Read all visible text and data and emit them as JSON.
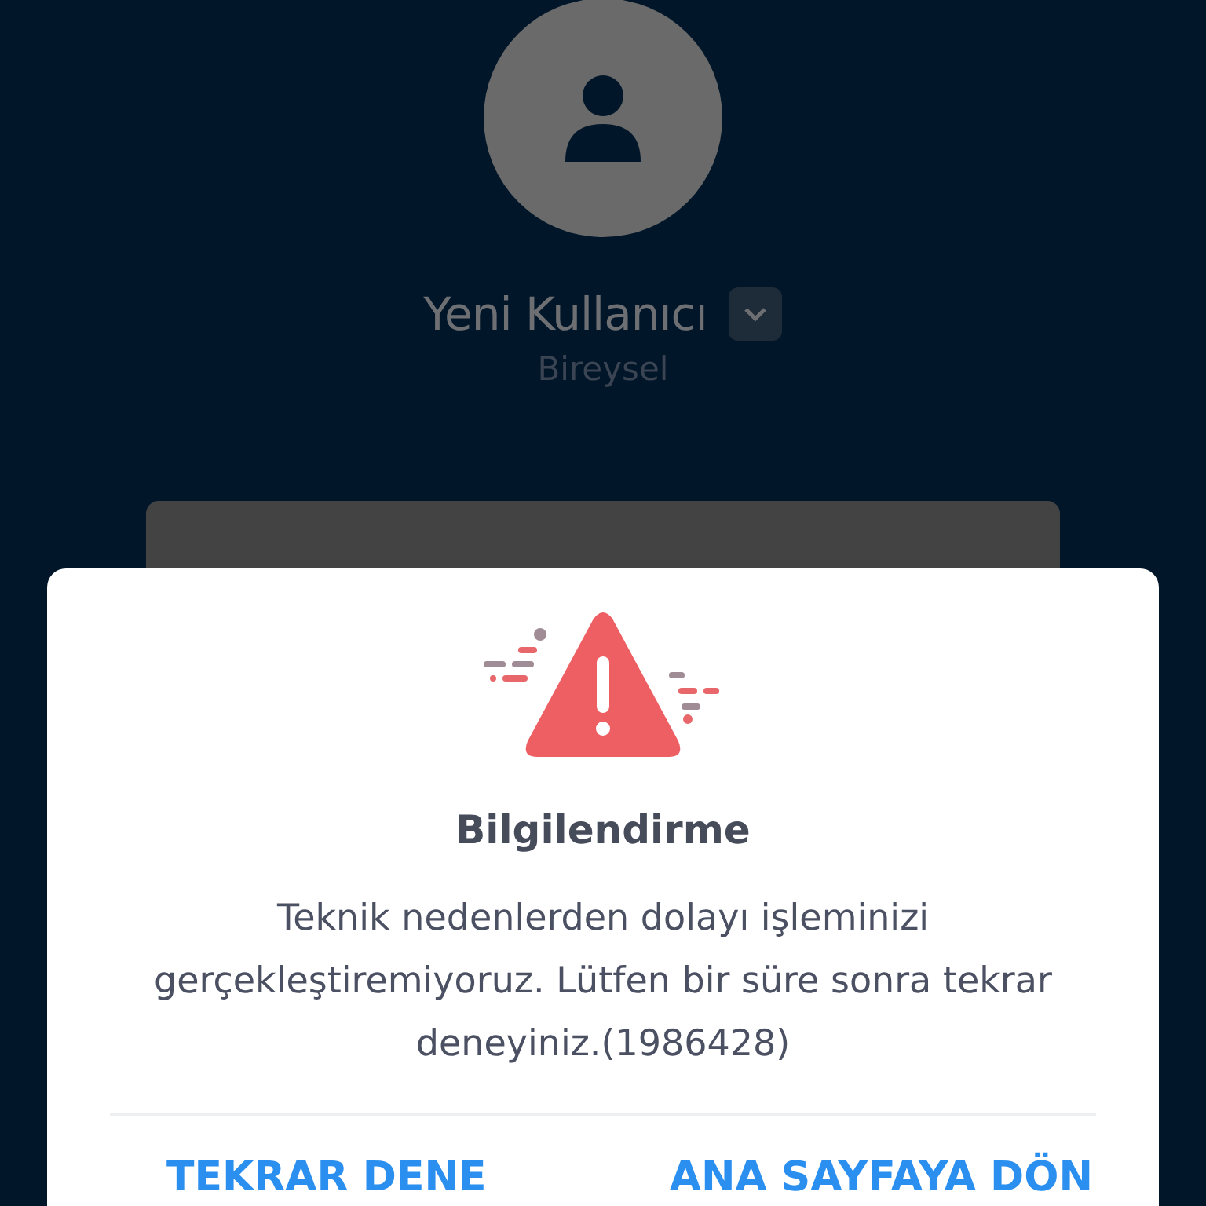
{
  "profile": {
    "name": "Yeni Kullanıcı",
    "type": "Bireysel"
  },
  "dialog": {
    "title": "Bilgilendirme",
    "message": "Teknik nedenlerden dolayı işleminizi gerçekleştiremiyoruz. Lütfen bir süre sonra tekrar deneyiniz.(1986428)",
    "buttons": [
      "TEKRAR DENE",
      "ANA SAYFAYA DÖN"
    ]
  }
}
